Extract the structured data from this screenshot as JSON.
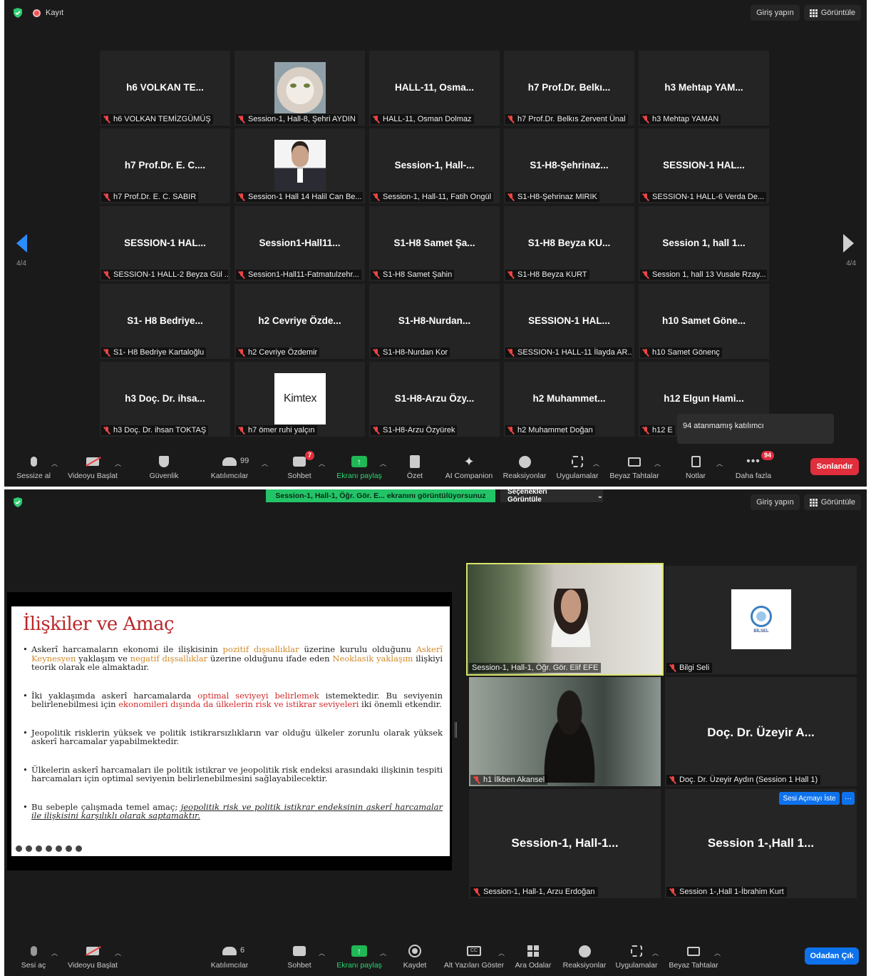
{
  "top_window": {
    "recording_label": "Kayıt",
    "signin_label": "Giriş yapın",
    "view_label": "Görüntüle",
    "page_indicator": "4/4",
    "tiles": [
      {
        "big": "h6 VOLKAN TE...",
        "name": "h6 VOLKAN TEMİZGÜMÜŞ",
        "photo": ""
      },
      {
        "big": "",
        "name": "Session-1, Hall-8, Şehri AYDIN",
        "photo": "cat"
      },
      {
        "big": "HALL-11, Osma...",
        "name": "HALL-11, Osman Dolmaz",
        "photo": ""
      },
      {
        "big": "h7 Prof.Dr. Belkı...",
        "name": "h7 Prof.Dr. Belkıs Zervent Ünal",
        "photo": ""
      },
      {
        "big": "h3 Mehtap YAM...",
        "name": "h3 Mehtap YAMAN",
        "photo": ""
      },
      {
        "big": "h7 Prof.Dr. E. C....",
        "name": "h7 Prof.Dr. E. C. SABIR",
        "photo": ""
      },
      {
        "big": "",
        "name": "Session-1 Hall 14 Halil Can Be...",
        "photo": "man"
      },
      {
        "big": "Session-1, Hall-...",
        "name": "Session-1, Hall-11, Fatih Ongül",
        "photo": ""
      },
      {
        "big": "S1-H8-Şehrinaz...",
        "name": "S1-H8-Şehrinaz MIRIK",
        "photo": ""
      },
      {
        "big": "SESSION-1 HAL...",
        "name": "SESSION-1 HALL-6 Verda De...",
        "photo": ""
      },
      {
        "big": "SESSION-1 HAL...",
        "name": "SESSION-1 HALL-2 Beyza Gül ...",
        "photo": ""
      },
      {
        "big": "Session1-Hall11...",
        "name": "Session1-Hall11-Fatmatulzehr...",
        "photo": ""
      },
      {
        "big": "S1-H8 Samet Şa...",
        "name": "S1-H8 Samet Şahin",
        "photo": ""
      },
      {
        "big": "S1-H8 Beyza KU...",
        "name": "S1-H8 Beyza KURT",
        "photo": ""
      },
      {
        "big": "Session 1, hall 1...",
        "name": "Session 1, hall 13 Vusale Rzay...",
        "photo": ""
      },
      {
        "big": "S1- H8 Bedriye...",
        "name": "S1- H8 Bedriye Kartaloğlu",
        "photo": ""
      },
      {
        "big": "h2 Cevriye Özde...",
        "name": "h2 Cevriye Özdemir",
        "photo": ""
      },
      {
        "big": "S1-H8-Nurdan...",
        "name": "S1-H8-Nurdan Kor",
        "photo": ""
      },
      {
        "big": "SESSION-1 HAL...",
        "name": "SESSION-1 HALL-11 İlayda AR...",
        "photo": ""
      },
      {
        "big": "h10 Samet Göne...",
        "name": "h10 Samet Gönenç",
        "photo": ""
      },
      {
        "big": "h3 Doç. Dr. ihsa...",
        "name": "h3 Doç. Dr. ihsan TOKTAŞ",
        "photo": ""
      },
      {
        "big": "",
        "name": "h7 ömer ruhi yalçın",
        "photo": "kimtex"
      },
      {
        "big": "S1-H8-Arzu Özy...",
        "name": "S1-H8-Arzu Özyürek",
        "photo": ""
      },
      {
        "big": "h2 Muhammet...",
        "name": "h2 Muhammet Doğan",
        "photo": ""
      },
      {
        "big": "h12 Elgun Hami...",
        "name": "h12 E",
        "photo": ""
      }
    ],
    "kimtex_text": "Kimtex",
    "tooltip": "94 atanmamış katılımcı",
    "toolbar": {
      "mute": "Sessize al",
      "video": "Videoyu Başlat",
      "security": "Güvenlik",
      "participants": "Katılımcılar",
      "participants_count": "99",
      "chat": "Sohbet",
      "chat_badge": "7",
      "share": "Ekranı paylaş",
      "summary": "Özet",
      "ai": "AI Companion",
      "reactions": "Reaksiyonlar",
      "apps": "Uygulamalar",
      "whiteboard": "Beyaz Tahtalar",
      "notes": "Notlar",
      "more": "Daha fazla",
      "more_badge": "94",
      "end": "Sonlandır"
    }
  },
  "bottom_window": {
    "share_banner": "Session-1, Hall-1, Öğr. Gör. E... ekranını görüntülüyorsunuz",
    "view_options": "Seçenekleri Görüntüle",
    "signin_label": "Giriş yapın",
    "view_label": "Görüntüle",
    "slide": {
      "title": "İlişkiler ve Amaç",
      "b1_a": "Askerî harcamaların ekonomi ile ilişkisinin ",
      "b1_b": "pozitif dışsallıklar",
      "b1_c": " üzerine kurulu olduğunu ",
      "b1_d": "Askerî Keynesyen",
      "b1_e": " yaklaşım ve ",
      "b1_f": "negatif dışsallıklar",
      "b1_g": " üzerine olduğunu ifade eden ",
      "b1_h": "Neoklasik yaklaşım",
      "b1_i": " ilişkiyi teorik olarak ele almaktadır.",
      "b2_a": "İki yaklaşımda askerî harcamalarda ",
      "b2_b": "optimal seviyeyi belirlemek",
      "b2_c": " istemektedir. Bu seviyenin belirlenebilmesi için ",
      "b2_d": "ekonomileri dışında da ülkelerin risk ve istikrar seviyeleri",
      "b2_e": " iki önemli etkendir.",
      "b3": "Jeopolitik risklerin yüksek ve politik istikrarsızlıkların var olduğu ülkeler zorunlu olarak yüksek askerî harcamalar yapabilmektedir.",
      "b4": "Ülkelerin askerî harcamaları ile politik istikrar ve jeopolitik risk endeksi arasındaki ilişkinin tespiti harcamaları için optimal seviyenin belirlenebilmesini sağlayabilecektir.",
      "b5_a": "Bu sebeple çalışmada temel amaç; ",
      "b5_b": "jeopolitik risk ve politik istikrar endeksinin askerî harcamalar ile ilişkisini karşılıklı olarak saptamaktır."
    },
    "tiles": {
      "t1_name": "Session-1, Hall-1, Öğr. Gör. Elif EFE",
      "t2_name": "Bilgi Seli",
      "t2_logo": "BİLSEL",
      "t3_name": "h1 İlkben Akansel",
      "t4_big": "Doç. Dr. Üzeyir A...",
      "t4_name": "Doç. Dr. Üzeyir Aydın (Session 1 Hall 1)",
      "t5_big": "Session-1, Hall-1...",
      "t5_name": "Session-1, Hall-1, Arzu Erdoğan",
      "t6_big": "Session 1-,Hall 1...",
      "t6_name": "Session 1-,Hall 1-İbrahim Kurt",
      "unmute_request": "Sesi Açmayı İste",
      "more_dots": "···"
    },
    "toolbar": {
      "unmute": "Sesi aç",
      "video": "Videoyu Başlat",
      "participants": "Katılımcılar",
      "participants_count": "6",
      "chat": "Sohbet",
      "share": "Ekranı paylaş",
      "record": "Kaydet",
      "captions": "Alt Yazıları Göster",
      "rooms": "Ara Odalar",
      "reactions": "Reaksiyonlar",
      "apps": "Uygulamalar",
      "whiteboard": "Beyaz Tahtalar",
      "leave": "Odadan Çık"
    }
  }
}
